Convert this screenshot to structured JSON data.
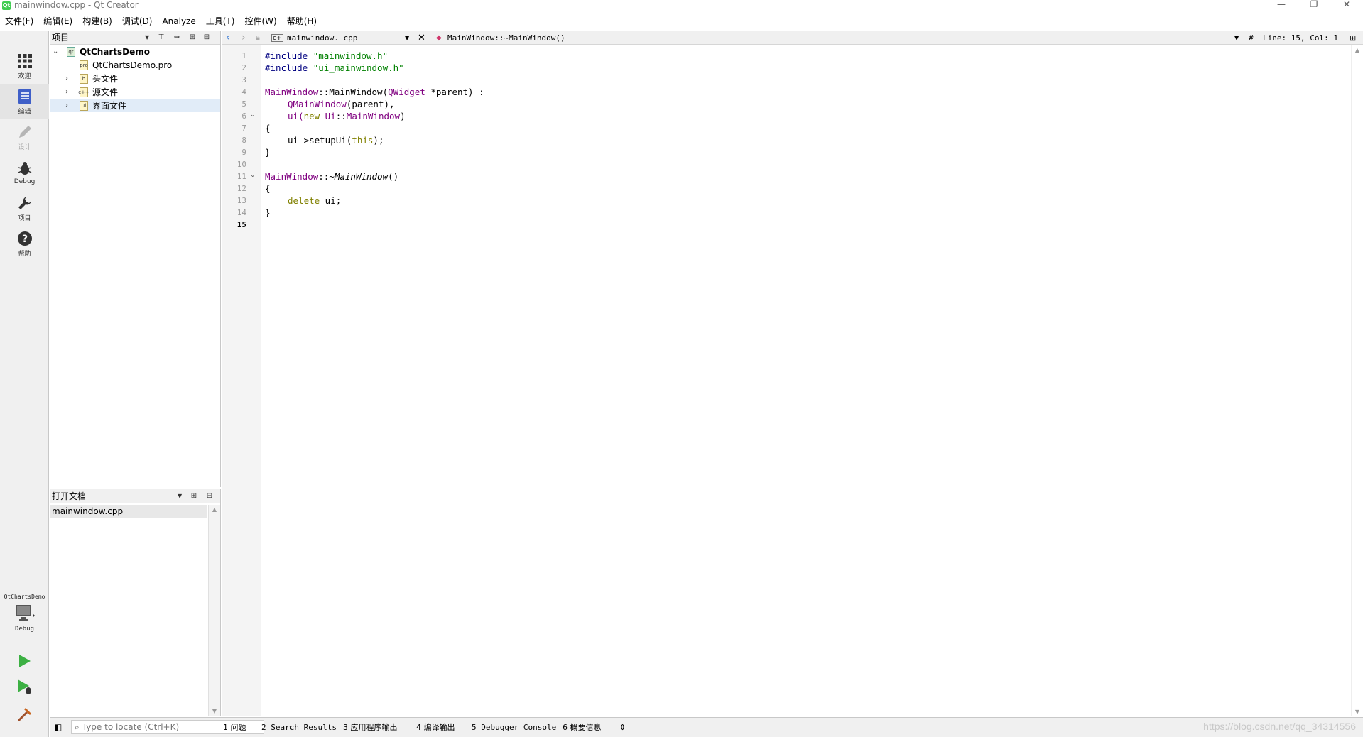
{
  "window": {
    "title": "mainwindow.cpp - Qt Creator",
    "app_icon": "qt-logo-icon",
    "controls": [
      "—",
      "❐",
      "✕"
    ]
  },
  "menu": [
    "文件(F)",
    "编辑(E)",
    "构建(B)",
    "调试(D)",
    "Analyze",
    "工具(T)",
    "控件(W)",
    "帮助(H)"
  ],
  "modes": [
    {
      "label": "欢迎",
      "icon": "grid-icon"
    },
    {
      "label": "编辑",
      "icon": "edit-doc-icon"
    },
    {
      "label": "设计",
      "icon": "pencil-icon"
    },
    {
      "label": "Debug",
      "icon": "bug-icon"
    },
    {
      "label": "项目",
      "icon": "wrench-icon"
    },
    {
      "label": "帮助",
      "icon": "help-icon"
    }
  ],
  "kit": {
    "project": "QtChartsDemo",
    "build": "Debug"
  },
  "project_panel": {
    "title": "项目",
    "tree": [
      {
        "label": "QtChartsDemo",
        "icon_text": "qt"
      },
      {
        "label": "QtChartsDemo.pro",
        "icon_text": "pro"
      },
      {
        "label": "头文件",
        "icon_text": "h"
      },
      {
        "label": "源文件",
        "icon_text": "c++"
      },
      {
        "label": "界面文件",
        "icon_text": "ui"
      }
    ]
  },
  "open_docs": {
    "title": "打开文档",
    "items": [
      "mainwindow.cpp"
    ]
  },
  "editor": {
    "file": "mainwindow. cpp",
    "symbol": "MainWindow::~MainWindow()",
    "position": "Line: 15, Col: 1",
    "hash": "#",
    "line_numbers": [
      "1",
      "2",
      "3",
      "4",
      "5",
      "6",
      "7",
      "8",
      "9",
      "10",
      "11",
      "12",
      "13",
      "14",
      "15"
    ],
    "fold_lines": [
      "6",
      "11"
    ],
    "current_line": "15"
  },
  "code": {
    "l1_pre": "#include ",
    "l1_str": "\"mainwindow.h\"",
    "l2_pre": "#include ",
    "l2_str": "\"ui_mainwindow.h\"",
    "l4_cls1": "MainWindow",
    "l4_sep": "::",
    "l4_fn": "MainWindow(",
    "l4_cls2": "QWidget",
    "l4_rest": " *parent) :",
    "l5_cls": "QMainWindow",
    "l5_rest": "(parent),",
    "l6_a": "ui(",
    "l6_kw": "new",
    "l6_cls1": " Ui",
    "l6_sep": "::",
    "l6_cls2": "MainWindow",
    "l6_end": ")",
    "l7": "{",
    "l8_a": "ui->setupUi(",
    "l8_kw": "this",
    "l8_end": ");",
    "l9": "}",
    "l11_cls": "MainWindow",
    "l11_sep": "::",
    "l11_fn": "~MainWindow",
    "l11_end": "()",
    "l12": "{",
    "l13_kw": "delete",
    "l13_rest": " ui;",
    "l14": "}"
  },
  "statusbar": {
    "locator_placeholder": "Type to locate (Ctrl+K)",
    "tabs": [
      "1  问题",
      "2  Search Results",
      "3  应用程序输出",
      "4  编译输出",
      "5  Debugger Console",
      "6  概要信息"
    ],
    "watermark": "https://blog.csdn.net/qq_34314556"
  },
  "colors": {
    "preprocessor": "#000080",
    "string": "#008000",
    "class": "#800080",
    "keyword": "#808000",
    "run_green": "#3cb043"
  }
}
